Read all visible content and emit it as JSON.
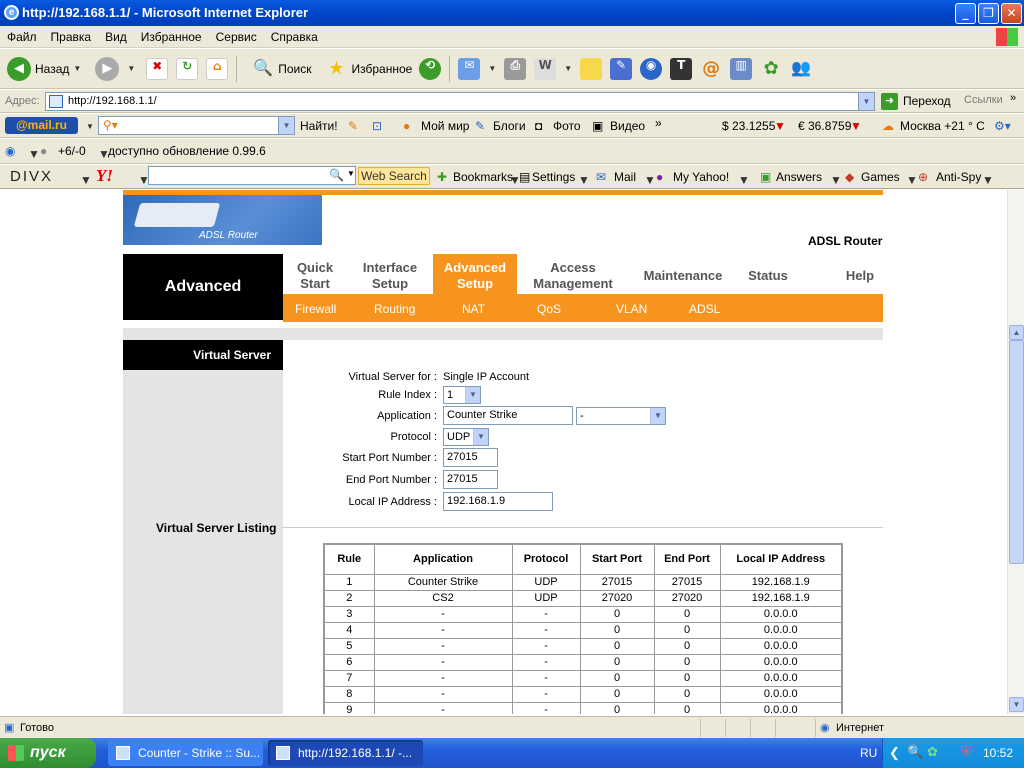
{
  "window": {
    "title": "http://192.168.1.1/ - Microsoft Internet Explorer"
  },
  "menu": [
    "Файл",
    "Правка",
    "Вид",
    "Избранное",
    "Сервис",
    "Справка"
  ],
  "toolbar": {
    "back": "Назад",
    "search": "Поиск",
    "favorites": "Избранное"
  },
  "address": {
    "label": "Адрес:",
    "url": "http://192.168.1.1/",
    "go": "Переход",
    "links": "Ссылки"
  },
  "mailbar": {
    "logo": "@mail.ru",
    "find": "Найти!",
    "my_world": "Мой мир",
    "blogs": "Блоги",
    "photo": "Фото",
    "video": "Видео",
    "usd": "$ 23.1255",
    "eur": "€ 36.8759",
    "weather": "Москва +21 ° C"
  },
  "updatebar": {
    "count": "+6/-0",
    "update": "доступно обновление 0.99.6"
  },
  "divxbar": {
    "divx": "DIVX",
    "yahoo": "Y!",
    "web_search": "Web Search",
    "bookmarks": "Bookmarks",
    "settings": "Settings",
    "mail": "Mail",
    "my_yahoo": "My Yahoo!",
    "answers": "Answers",
    "games": "Games",
    "antispy": "Anti-Spy"
  },
  "router": {
    "banner_text": "ADSL Router",
    "title": "ADSL Router",
    "section": "Advanced",
    "tabs": [
      {
        "line1": "Quick",
        "line2": "Start"
      },
      {
        "line1": "Interface",
        "line2": "Setup"
      },
      {
        "line1": "Advanced",
        "line2": "Setup"
      },
      {
        "line1": "Access",
        "line2": "Management"
      },
      {
        "line1": "Maintenance",
        "line2": ""
      },
      {
        "line1": "Status",
        "line2": ""
      },
      {
        "line1": "Help",
        "line2": ""
      }
    ],
    "subtabs": [
      "Firewall",
      "Routing",
      "NAT",
      "QoS",
      "VLAN",
      "ADSL"
    ],
    "side_label": "Virtual Server",
    "form": {
      "vs_for_label": "Virtual Server for :",
      "vs_for_value": "Single IP Account",
      "rule_index_label": "Rule Index :",
      "rule_index_value": "1",
      "application_label": "Application :",
      "application_value": "Counter Strike",
      "application_select": "-",
      "protocol_label": "Protocol :",
      "protocol_value": "UDP",
      "start_port_label": "Start Port Number :",
      "start_port_value": "27015",
      "end_port_label": "End Port Number :",
      "end_port_value": "27015",
      "local_ip_label": "Local IP Address :",
      "local_ip_value": "192.168.1.9"
    },
    "listing_title": "Virtual Server Listing",
    "table": {
      "headers": [
        "Rule",
        "Application",
        "Protocol",
        "Start Port",
        "End Port",
        "Local IP Address"
      ],
      "rows": [
        [
          "1",
          "Counter Strike",
          "UDP",
          "27015",
          "27015",
          "192.168.1.9"
        ],
        [
          "2",
          "CS2",
          "UDP",
          "27020",
          "27020",
          "192.168.1.9"
        ],
        [
          "3",
          "-",
          "-",
          "0",
          "0",
          "0.0.0.0"
        ],
        [
          "4",
          "-",
          "-",
          "0",
          "0",
          "0.0.0.0"
        ],
        [
          "5",
          "-",
          "-",
          "0",
          "0",
          "0.0.0.0"
        ],
        [
          "6",
          "-",
          "-",
          "0",
          "0",
          "0.0.0.0"
        ],
        [
          "7",
          "-",
          "-",
          "0",
          "0",
          "0.0.0.0"
        ],
        [
          "8",
          "-",
          "-",
          "0",
          "0",
          "0.0.0.0"
        ],
        [
          "9",
          "-",
          "-",
          "0",
          "0",
          "0.0.0.0"
        ]
      ]
    }
  },
  "status": {
    "left": "Готово",
    "zone": "Интернет"
  },
  "taskbar": {
    "start": "пуск",
    "task1": "Counter - Strike :: Su...",
    "task2": "http://192.168.1.1/ -...",
    "lang": "RU",
    "clock": "10:52"
  },
  "colors": {
    "accent": "#f7941d",
    "title_bar": "#0a5be0",
    "taskbar": "#245edb"
  }
}
